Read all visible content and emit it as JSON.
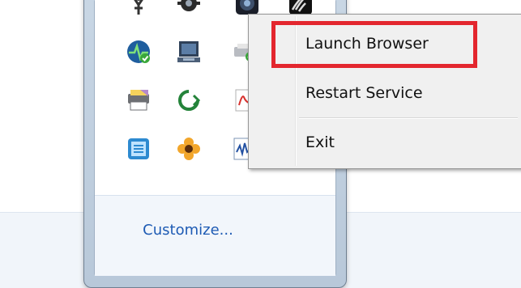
{
  "context_menu": {
    "items": [
      {
        "label": "Launch Browser"
      },
      {
        "label": "Restart Service"
      },
      {
        "label": "Exit"
      }
    ]
  },
  "tray": {
    "customize_label": "Customize...",
    "icons": [
      "network-antenna-icon",
      "gear-cog-icon",
      "webcam-icon",
      "wireless-signal-icon",
      "heartbeat-monitor-icon",
      "laptop-screen-icon",
      "printer-check-icon",
      "media-player-icon",
      "printer-folder-icon",
      "refresh-arrow-icon",
      "pdf-document-icon",
      "calculator-app-icon",
      "flower-icon",
      "waveform-monitor-icon"
    ]
  },
  "colors": {
    "highlight": "#e3262e",
    "link": "#1e5bb4"
  }
}
